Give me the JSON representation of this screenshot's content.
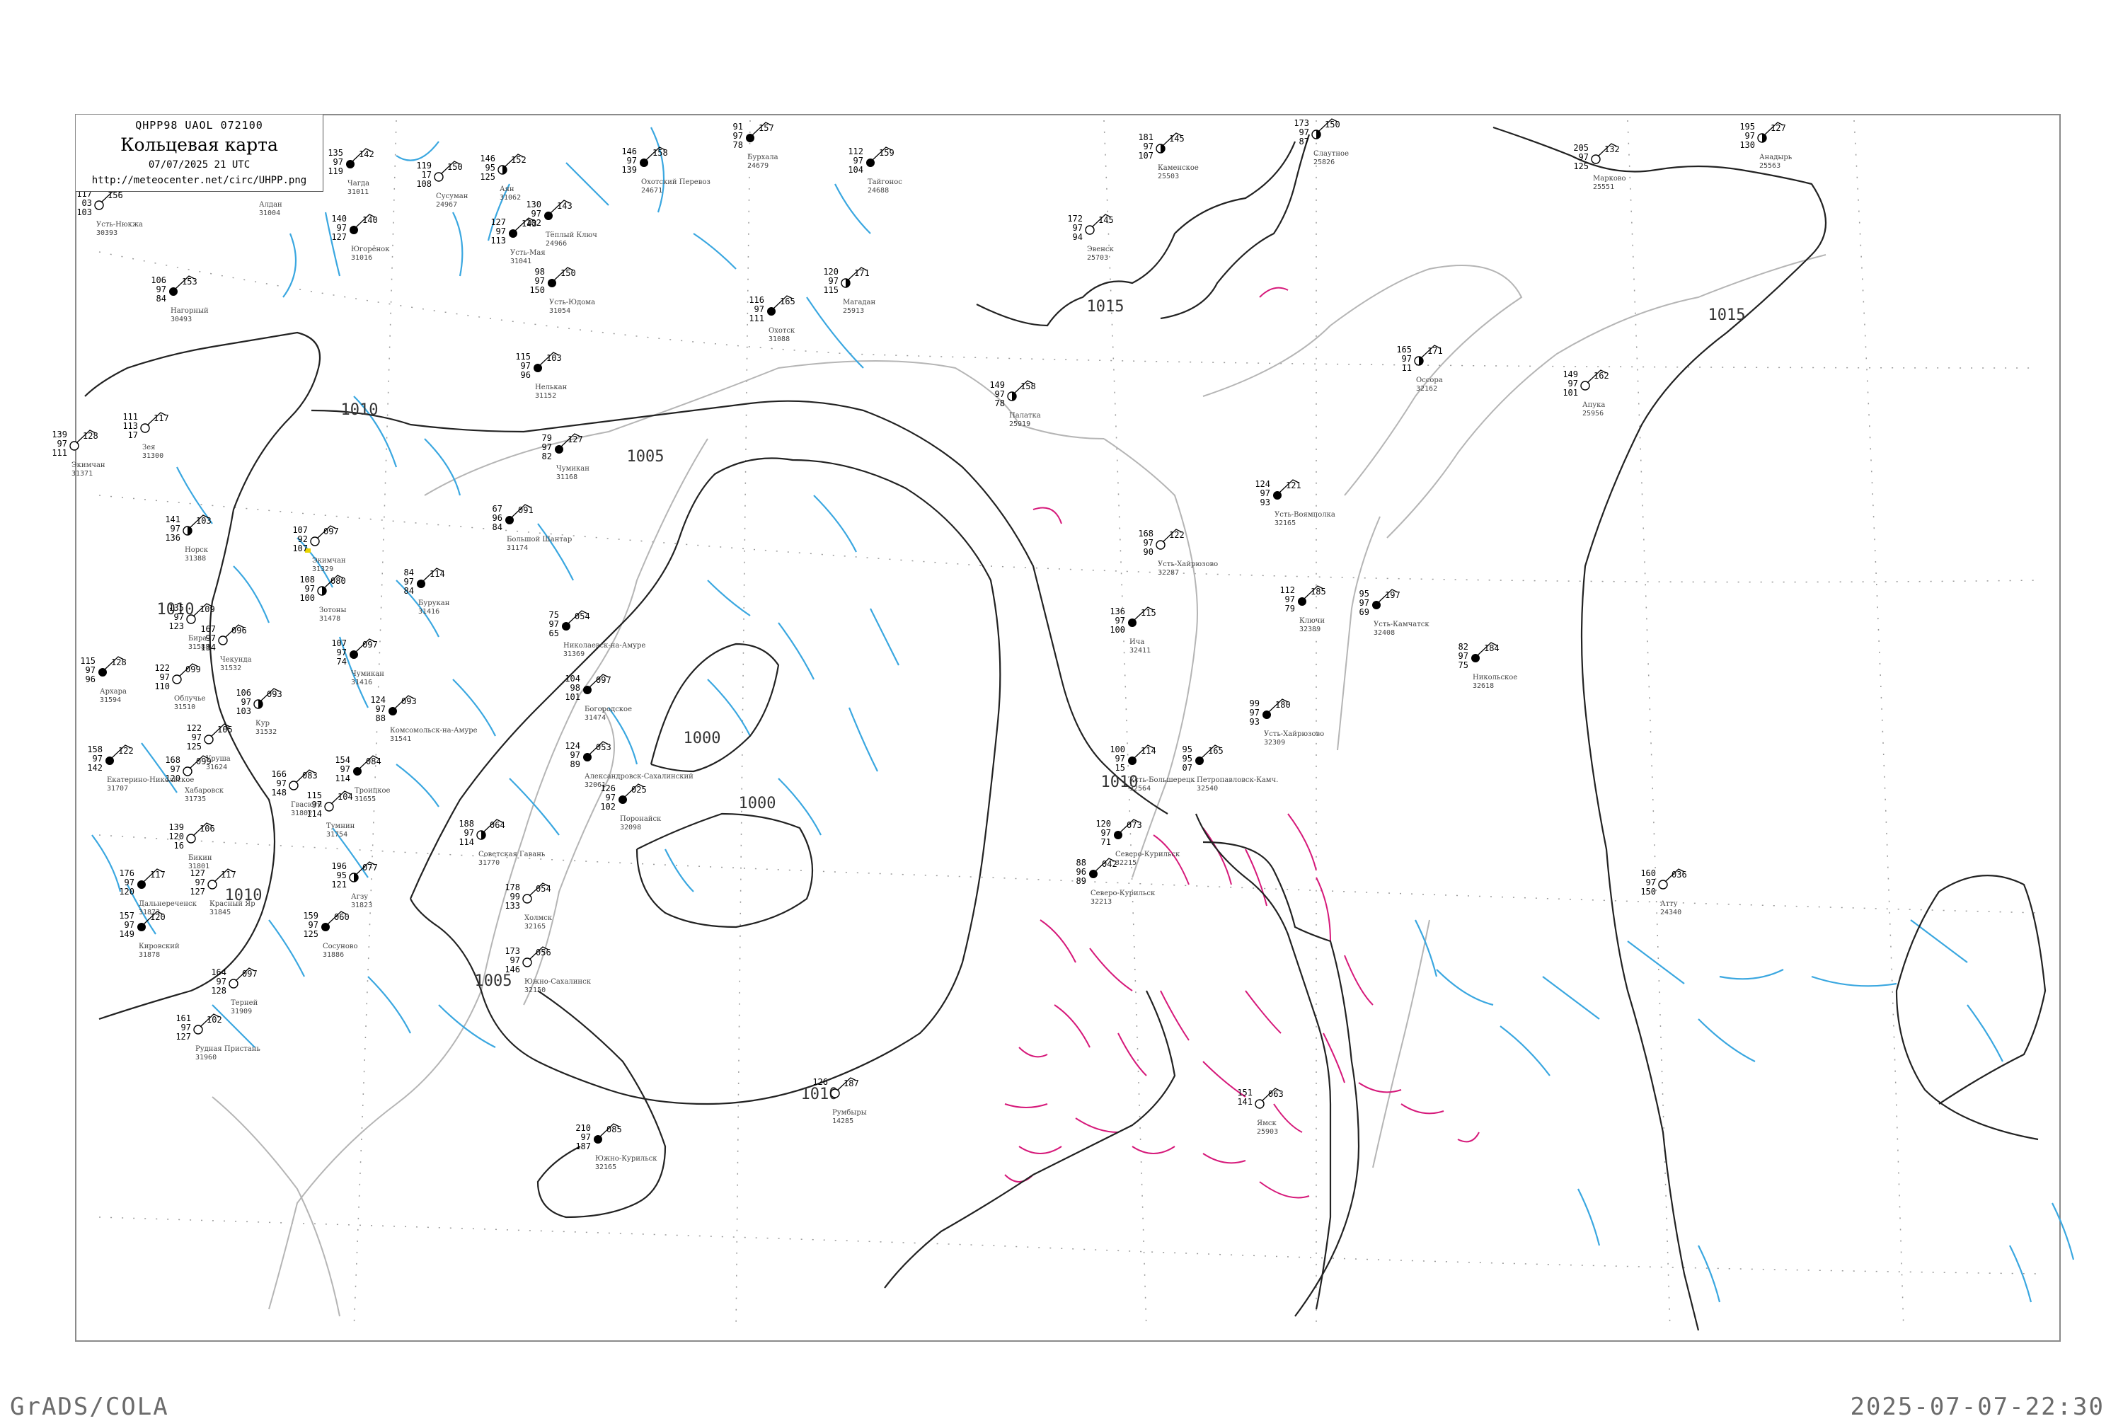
{
  "header": {
    "code_line": "QHPP98  UAOL  072100",
    "title": "Кольцевая карта",
    "datetime": "07/07/2025 21 UTC",
    "url": "http://meteocenter.net/circ/UHPP.png"
  },
  "footer": {
    "left": "GrADS/COLA",
    "right": "2025-07-07-22:30"
  },
  "isobars": [
    {
      "label": "1015"
    },
    {
      "label": "1015"
    },
    {
      "label": "1010"
    },
    {
      "label": "1010"
    },
    {
      "label": "1010"
    },
    {
      "label": "1005"
    },
    {
      "label": "1005"
    },
    {
      "label": "1000"
    },
    {
      "label": "1000"
    },
    {
      "label": "1010"
    },
    {
      "label": "1010"
    }
  ],
  "stations": [
    {
      "name": "Усть-Нюкжа",
      "id": "30393",
      "pressure": "156",
      "values": [
        "117",
        "03",
        "103"
      ],
      "cloud": "empty"
    },
    {
      "name": "Нагорный",
      "id": "30493",
      "pressure": "153",
      "values": [
        "106",
        "97",
        "84"
      ],
      "cloud": "full"
    },
    {
      "name": "Чагда",
      "id": "31011",
      "pressure": "142",
      "values": [
        "135",
        "97",
        "119"
      ],
      "cloud": "full"
    },
    {
      "name": "Югорёнок",
      "id": "31016",
      "pressure": "140",
      "values": [
        "140",
        "97",
        "127"
      ],
      "cloud": "full"
    },
    {
      "name": "Зея",
      "id": "31300",
      "pressure": "117",
      "values": [
        "111",
        "113",
        "17"
      ],
      "cloud": "empty"
    },
    {
      "name": "Норск",
      "id": "31388",
      "pressure": "103",
      "values": [
        "141",
        "97",
        "136"
      ],
      "cloud": "half"
    },
    {
      "name": "Экимчан",
      "id": "31329",
      "pressure": "097",
      "values": [
        "107",
        "92",
        "107"
      ],
      "cloud": "fog"
    },
    {
      "name": "Аян",
      "id": "31062",
      "pressure": "152",
      "values": [
        "146",
        "95",
        "125"
      ],
      "cloud": "half"
    },
    {
      "name": "Усть-Мая",
      "id": "31041",
      "pressure": "143",
      "values": [
        "127",
        "97",
        "113"
      ],
      "cloud": "full"
    },
    {
      "name": "Усть-Юдома",
      "id": "31054",
      "pressure": "150",
      "values": [
        "98",
        "97",
        "150"
      ],
      "cloud": "full"
    },
    {
      "name": "Нелькан",
      "id": "31152",
      "pressure": "103",
      "values": [
        "115",
        "97",
        "96"
      ],
      "cloud": "full"
    },
    {
      "name": "Чумикан",
      "id": "31168",
      "pressure": "127",
      "values": [
        "79",
        "97",
        "82"
      ],
      "cloud": "full"
    },
    {
      "name": "Большой Шантар",
      "id": "31174",
      "pressure": "091",
      "values": [
        "67",
        "96",
        "84"
      ],
      "cloud": "full"
    },
    {
      "name": "Зотоны",
      "id": "31478",
      "pressure": "080",
      "values": [
        "108",
        "97",
        "100"
      ],
      "cloud": "half"
    },
    {
      "name": "Бурукан",
      "id": "31416",
      "pressure": "114",
      "values": [
        "84",
        "97",
        "84"
      ],
      "cloud": "full"
    },
    {
      "name": "Николаевск-на-Амуре",
      "id": "31369",
      "pressure": "054",
      "values": [
        "75",
        "97",
        "65"
      ],
      "cloud": "full"
    },
    {
      "name": "Богородское",
      "id": "31474",
      "pressure": "097",
      "values": [
        "104",
        "98",
        "101"
      ],
      "cloud": "full"
    },
    {
      "name": "Комсомольск-на-Амуре",
      "id": "31541",
      "pressure": "093",
      "values": [
        "124",
        "97",
        "88"
      ],
      "cloud": "full"
    },
    {
      "name": "Троицкое",
      "id": "31655",
      "pressure": "084",
      "values": [
        "154",
        "97",
        "114"
      ],
      "cloud": "full"
    },
    {
      "name": "Советская Гавань",
      "id": "31770",
      "pressure": "064",
      "values": [
        "188",
        "97",
        "114"
      ],
      "cloud": "half"
    },
    {
      "name": "Александровск-Сахалинский",
      "id": "32061",
      "pressure": "053",
      "values": [
        "124",
        "97",
        "89"
      ],
      "cloud": "full"
    },
    {
      "name": "Поронайск",
      "id": "32098",
      "pressure": "025",
      "values": [
        "126",
        "97",
        "102"
      ],
      "cloud": "full"
    },
    {
      "name": "Холмск",
      "id": "32165",
      "pressure": "054",
      "values": [
        "178",
        "99",
        "133"
      ],
      "cloud": "empty"
    },
    {
      "name": "Южно-Сахалинск",
      "id": "32150",
      "pressure": "056",
      "values": [
        "173",
        "97",
        "146"
      ],
      "cloud": "empty"
    },
    {
      "name": "Южно-Курильск",
      "id": "32165",
      "pressure": "085",
      "values": [
        "210",
        "97",
        "187"
      ],
      "cloud": "full"
    },
    {
      "name": "Румбыры",
      "id": "14285",
      "pressure": "187",
      "values": [
        "126"
      ],
      "cloud": "empty"
    },
    {
      "name": "Охотск",
      "id": "31088",
      "pressure": "165",
      "values": [
        "116",
        "97",
        "111"
      ],
      "cloud": "full"
    },
    {
      "name": "Магадан",
      "id": "25913",
      "pressure": "171",
      "values": [
        "120",
        "97",
        "115"
      ],
      "cloud": "half"
    },
    {
      "name": "Палатка",
      "id": "25919",
      "pressure": "158",
      "values": [
        "149",
        "97",
        "78"
      ],
      "cloud": "half"
    },
    {
      "name": "Усть-Большерецк",
      "id": "32564",
      "pressure": "114",
      "values": [
        "100",
        "97",
        "15"
      ],
      "cloud": "full"
    },
    {
      "name": "Петропавловск-Камч.",
      "id": "32540",
      "pressure": "165",
      "values": [
        "95",
        "95",
        "07"
      ],
      "cloud": "full"
    },
    {
      "name": "Ича",
      "id": "32411",
      "pressure": "115",
      "values": [
        "136",
        "97",
        "100"
      ],
      "cloud": "full"
    },
    {
      "name": "Усть-Хайрюзово",
      "id": "32287",
      "pressure": "122",
      "values": [
        "168",
        "97",
        "90"
      ],
      "cloud": "empty"
    },
    {
      "name": "Ключи",
      "id": "32389",
      "pressure": "185",
      "values": [
        "112",
        "97",
        "79"
      ],
      "cloud": "full"
    },
    {
      "name": "Усть-Камчатск",
      "id": "32408",
      "pressure": "197",
      "values": [
        "95",
        "97",
        "69"
      ],
      "cloud": "full"
    },
    {
      "name": "Никольское",
      "id": "32618",
      "pressure": "184",
      "values": [
        "82",
        "97",
        "75"
      ],
      "cloud": "full"
    },
    {
      "name": "Северо-Курильск",
      "id": "32215",
      "pressure": "073",
      "values": [
        "120",
        "97",
        "71"
      ],
      "cloud": "full"
    },
    {
      "name": "Северо-Курильск",
      "id": "32213",
      "pressure": "042",
      "values": [
        "88",
        "96",
        "89"
      ],
      "cloud": "full"
    },
    {
      "name": "Атту",
      "id": "24340",
      "pressure": "036",
      "values": [
        "160",
        "97",
        "150"
      ],
      "cloud": "empty"
    },
    {
      "name": "Усть-Хайрюзово",
      "id": "32309",
      "pressure": "180",
      "values": [
        "99",
        "97",
        "93"
      ],
      "cloud": "full"
    },
    {
      "name": "Каменское",
      "id": "25503",
      "pressure": "145",
      "values": [
        "181",
        "97",
        "107"
      ],
      "cloud": "half"
    },
    {
      "name": "Эвенск",
      "id": "25703",
      "pressure": "145",
      "values": [
        "172",
        "97",
        "94"
      ],
      "cloud": "empty"
    },
    {
      "name": "Слаутное",
      "id": "25826",
      "pressure": "150",
      "values": [
        "173",
        "97",
        "87"
      ],
      "cloud": "half"
    },
    {
      "name": "Марково",
      "id": "25551",
      "pressure": "132",
      "values": [
        "205",
        "97",
        "125"
      ],
      "cloud": "empty"
    },
    {
      "name": "Анадырь",
      "id": "25563",
      "pressure": "127",
      "values": [
        "195",
        "97",
        "130"
      ],
      "cloud": "half"
    },
    {
      "name": "Апука",
      "id": "25956",
      "pressure": "162",
      "values": [
        "149",
        "97",
        "101"
      ],
      "cloud": "empty"
    },
    {
      "name": "Оссора",
      "id": "32162",
      "pressure": "171",
      "values": [
        "165",
        "97",
        "11"
      ],
      "cloud": "half"
    },
    {
      "name": "Усть-Воямполка",
      "id": "32165",
      "pressure": "121",
      "values": [
        "124",
        "97",
        "93"
      ],
      "cloud": "full"
    },
    {
      "name": "Тайгонос",
      "id": "24688",
      "pressure": "159",
      "values": [
        "112",
        "97",
        "104"
      ],
      "cloud": "full"
    },
    {
      "name": "Охотский Перевоз",
      "id": "24671",
      "pressure": "158",
      "values": [
        "146",
        "97",
        "139"
      ],
      "cloud": "full"
    },
    {
      "name": "Бурхала",
      "id": "24679",
      "pressure": "157",
      "values": [
        "91",
        "97",
        "78"
      ],
      "cloud": "full"
    },
    {
      "name": "Хабаровск",
      "id": "31735",
      "pressure": "099",
      "values": [
        "168",
        "97",
        "120"
      ],
      "cloud": "empty"
    },
    {
      "name": "Екатерино-Никольское",
      "id": "31707",
      "pressure": "122",
      "values": [
        "158",
        "97",
        "142"
      ],
      "cloud": "full"
    },
    {
      "name": "Бикин",
      "id": "31801",
      "pressure": "106",
      "values": [
        "139",
        "120",
        "16"
      ],
      "cloud": "empty"
    },
    {
      "name": "Красный Яр",
      "id": "31845",
      "pressure": "117",
      "values": [
        "127",
        "97",
        "127"
      ],
      "cloud": "empty"
    },
    {
      "name": "Дальнереченск",
      "id": "31873",
      "pressure": "117",
      "values": [
        "176",
        "97",
        "120"
      ],
      "cloud": "full"
    },
    {
      "name": "Кировский",
      "id": "31878",
      "pressure": "120",
      "values": [
        "157",
        "97",
        "149"
      ],
      "cloud": "full"
    },
    {
      "name": "Рудная Пристань",
      "id": "31960",
      "pressure": "102",
      "values": [
        "161",
        "97",
        "127"
      ],
      "cloud": "empty"
    },
    {
      "name": "Терней",
      "id": "31909",
      "pressure": "097",
      "values": [
        "164",
        "97",
        "128"
      ],
      "cloud": "empty"
    },
    {
      "name": "Сосуново",
      "id": "31886",
      "pressure": "060",
      "values": [
        "159",
        "97",
        "125"
      ],
      "cloud": "full"
    },
    {
      "name": "Агзу",
      "id": "31823",
      "pressure": "077",
      "values": [
        "196",
        "95",
        "121"
      ],
      "cloud": "half"
    },
    {
      "name": "Тумнин",
      "id": "31754",
      "pressure": "104",
      "values": [
        "115",
        "97",
        "114"
      ],
      "cloud": "empty"
    },
    {
      "name": "Гвасюги",
      "id": "31802",
      "pressure": "083",
      "values": [
        "166",
        "97",
        "148"
      ],
      "cloud": "empty"
    },
    {
      "name": "Уруша",
      "id": "31624",
      "pressure": "105",
      "values": [
        "122",
        "97",
        "125"
      ],
      "cloud": "empty"
    },
    {
      "name": "Архара",
      "id": "31594",
      "pressure": "128",
      "values": [
        "115",
        "97",
        "96"
      ],
      "cloud": "full"
    },
    {
      "name": "Кур",
      "id": "31532",
      "pressure": "093",
      "values": [
        "106",
        "97",
        "103"
      ],
      "cloud": "half"
    },
    {
      "name": "Чекунда",
      "id": "31532",
      "pressure": "096",
      "values": [
        "167",
        "97",
        "134"
      ],
      "cloud": "empty"
    },
    {
      "name": "Экимчан",
      "id": "31371",
      "pressure": "128",
      "values": [
        "139",
        "97",
        "111"
      ],
      "cloud": "empty"
    },
    {
      "name": "Чумикан",
      "id": "31416",
      "pressure": "097",
      "values": [
        "107",
        "97",
        "74"
      ],
      "cloud": "full"
    },
    {
      "name": "Облучье",
      "id": "31510",
      "pressure": "099",
      "values": [
        "122",
        "97",
        "110"
      ],
      "cloud": "empty"
    },
    {
      "name": "Бира",
      "id": "31588",
      "pressure": "109",
      "values": [
        "135",
        "97",
        "123"
      ],
      "cloud": "empty"
    },
    {
      "name": "Сусуман",
      "id": "24967",
      "pressure": "150",
      "values": [
        "119",
        "17",
        "108"
      ],
      "cloud": "empty"
    },
    {
      "name": "Тёплый Ключ",
      "id": "24966",
      "pressure": "143",
      "values": [
        "130",
        "97",
        "102"
      ],
      "cloud": "full"
    },
    {
      "name": "Ямск",
      "id": "25903",
      "pressure": "063",
      "values": [
        "151",
        "141"
      ],
      "cloud": "empty"
    },
    {
      "name": "Алдан",
      "id": "31004",
      "pressure": "",
      "values": [],
      "cloud": "empty"
    }
  ]
}
